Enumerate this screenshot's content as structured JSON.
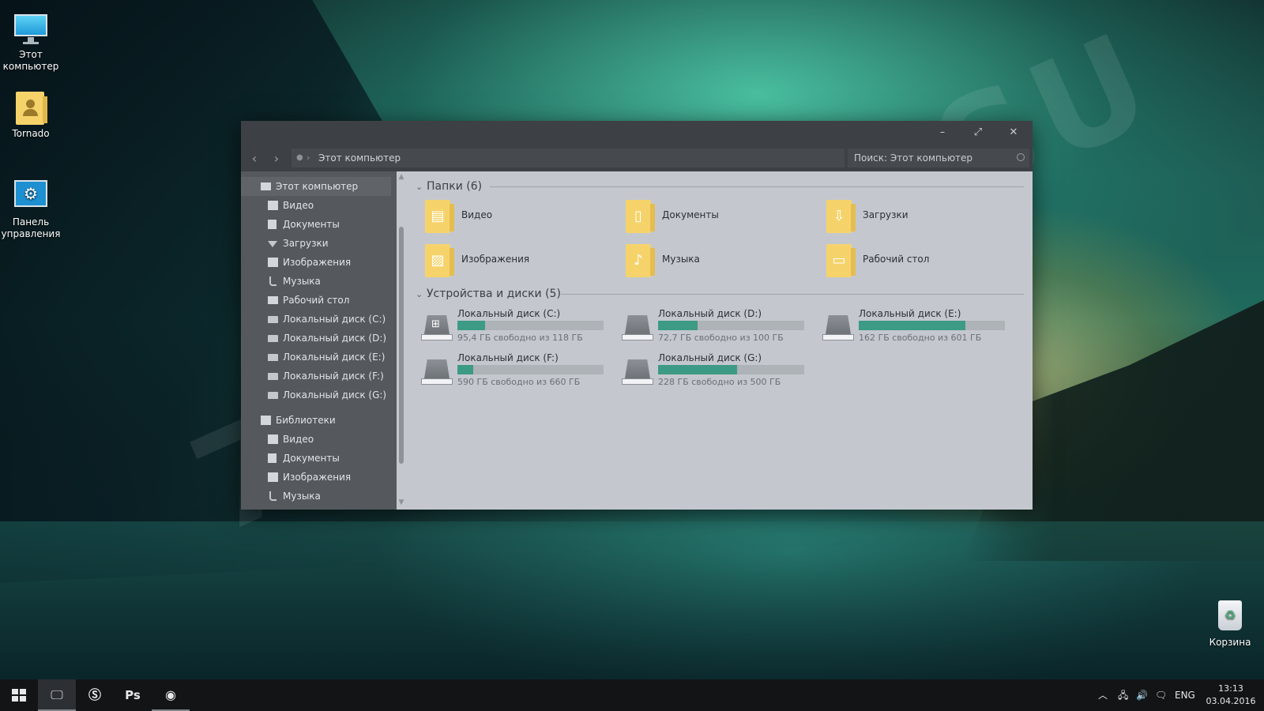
{
  "desktop": {
    "icons": [
      {
        "label": "Этот компьютер"
      },
      {
        "label": "Tornado"
      },
      {
        "label": "Панель управления"
      },
      {
        "label": "Корзина"
      }
    ],
    "watermark": "7THEMES.SU"
  },
  "window": {
    "address": {
      "crumb": "Этот компьютер"
    },
    "search": {
      "placeholder": "Поиск: Этот компьютер"
    },
    "nav": {
      "root": "Этот компьютер",
      "items": [
        "Видео",
        "Документы",
        "Загрузки",
        "Изображения",
        "Музыка",
        "Рабочий стол",
        "Локальный диск (C:)",
        "Локальный диск (D:)",
        "Локальный диск (E:)",
        "Локальный диск (F:)",
        "Локальный диск (G:)"
      ],
      "libraries": "Библиотеки",
      "library_items": [
        "Видео",
        "Документы",
        "Изображения",
        "Музыка"
      ]
    },
    "folders_section": "Папки (6)",
    "folders": [
      {
        "label": "Видео",
        "icon": "video-icon"
      },
      {
        "label": "Документы",
        "icon": "document-icon"
      },
      {
        "label": "Загрузки",
        "icon": "download-icon"
      },
      {
        "label": "Изображения",
        "icon": "picture-icon"
      },
      {
        "label": "Музыка",
        "icon": "music-icon"
      },
      {
        "label": "Рабочий стол",
        "icon": "desktop-icon"
      }
    ],
    "devices_section": "Устройства и диски (5)",
    "drives": [
      {
        "name": "Локальный диск (C:)",
        "free": "95,4 ГБ свободно из 118 ГБ",
        "used_fraction": 0.19,
        "system": true
      },
      {
        "name": "Локальный диск (D:)",
        "free": "72,7 ГБ свободно из 100 ГБ",
        "used_fraction": 0.27
      },
      {
        "name": "Локальный диск (E:)",
        "free": "162 ГБ свободно из 601 ГБ",
        "used_fraction": 0.73
      },
      {
        "name": "Локальный диск (F:)",
        "free": "590 ГБ свободно из 660 ГБ",
        "used_fraction": 0.11
      },
      {
        "name": "Локальный диск (G:)",
        "free": "228 ГБ свободно из 500 ГБ",
        "used_fraction": 0.54
      }
    ]
  },
  "taskbar": {
    "apps": [
      "start-icon",
      "explorer-icon",
      "skype-icon",
      "photoshop-icon",
      "chrome-icon"
    ],
    "photoshop_label": "Ps",
    "language": "ENG",
    "time": "13:13",
    "date": "03.04.2016"
  },
  "colors": {
    "accent": "#3d9a84",
    "window_chrome": "#3d4044",
    "nav_pane": "#55595e",
    "content_bg": "#c4c8ce",
    "folder_yellow": "#f6d36a"
  }
}
